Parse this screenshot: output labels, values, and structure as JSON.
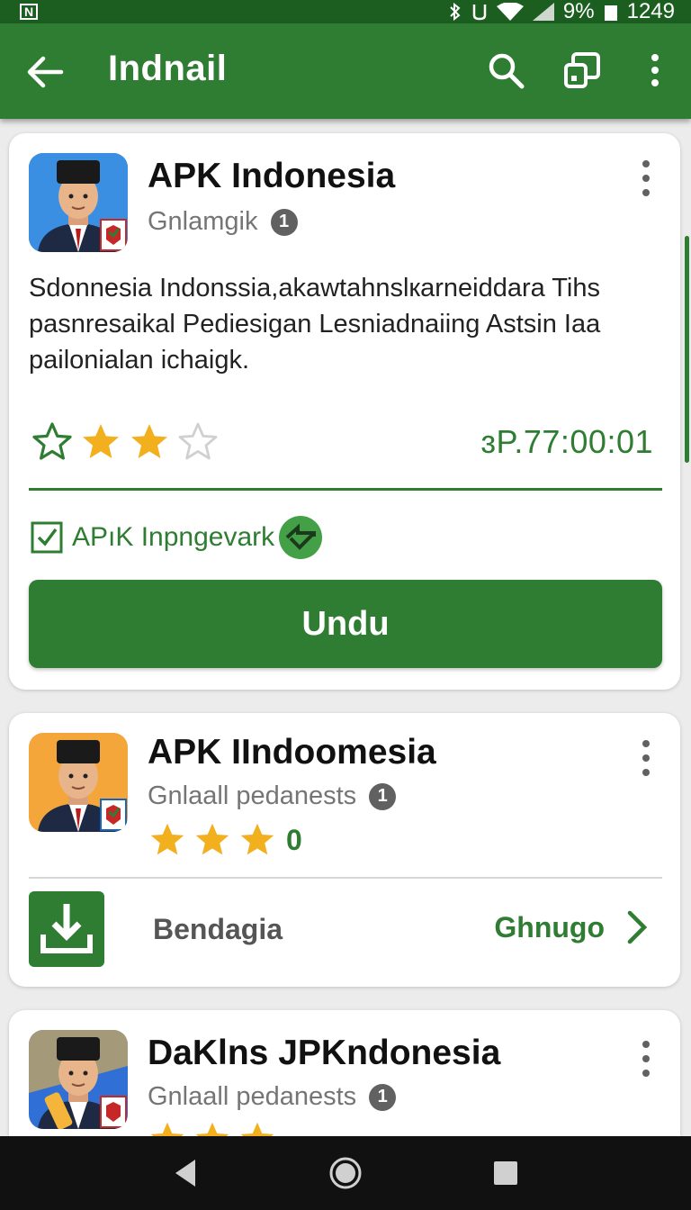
{
  "status_bar": {
    "battery": "9%",
    "time": "1249",
    "icons": [
      "notification-icon",
      "bluetooth-icon",
      "vibrate-icon",
      "wifi-icon",
      "signal-icon",
      "battery-icon"
    ]
  },
  "app_bar": {
    "title": "Indnail",
    "icons": [
      "back-arrow-icon",
      "search-icon",
      "cast-icon",
      "more-vert-icon"
    ]
  },
  "colors": {
    "primary": "#2e7d32",
    "primary_dark": "#1b5e20",
    "star": "#f2b01e"
  },
  "cards": [
    {
      "title": "APK Indonesia",
      "subtitle": "Gnlamgik",
      "badge": "1",
      "description": "Sdonnesia Indonssia,akawtahnslкarneiddara Tihs pasnresaikal Pediesigan Lesniadnaiing Astsin Iaa pailonialan ichaigk.",
      "rating": {
        "filled": 2,
        "total": 4
      },
      "time": "ɜP.77:00:01",
      "checkbox_label": "APıK Inpngevark",
      "checkbox_checked": true,
      "button_label": "Undu"
    },
    {
      "title": "APK IIndoomesia",
      "subtitle": "Gnlaall pedanests",
      "badge": "1",
      "rating": {
        "filled": 3,
        "total": 3
      },
      "rating_suffix": "0",
      "secondary_label": "Bendagia",
      "action_label": "Ghnugo"
    },
    {
      "title": "DaKlns JPKndonesia",
      "subtitle": "Gnlaall pedanests",
      "badge": "1"
    }
  ],
  "nav_bar": {
    "icons": [
      "back-triangle-icon",
      "home-circle-icon",
      "recents-square-icon"
    ]
  }
}
